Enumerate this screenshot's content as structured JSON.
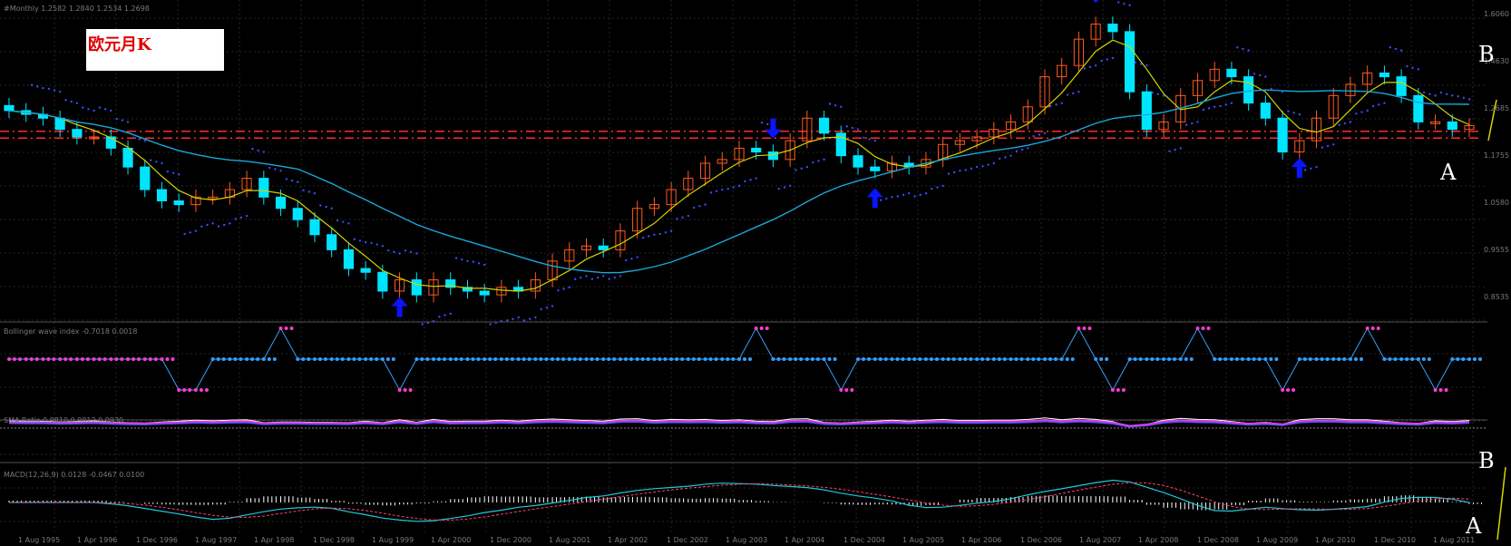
{
  "title_label": "欧元月K",
  "annotations": {
    "b_upper": "B",
    "a_upper": "A",
    "b_lower": "B",
    "a_lower": "A"
  },
  "panel_headers": {
    "main": "#Monthly  1.2582  1.2840  1.2534  1.2698",
    "panel2": "Bollinger wave index  -0.7018  0.0018",
    "panel3": "SMA Ratio 0.9810 0.9812 0.0930",
    "panel4": "MACD(12,26,9)  0.0128  -0.0467  0.0100"
  },
  "x_tick_labels": [
    "1 Aug 1995",
    "1 Apr 1996",
    "1 Dec 1996",
    "1 Aug 1997",
    "1 Apr 1998",
    "1 Dec 1998",
    "1 Aug 1999",
    "1 Apr 2000",
    "1 Dec 2000",
    "1 Aug 2001",
    "1 Apr 2002",
    "1 Dec 2002",
    "1 Aug 2003",
    "1 Apr 2004",
    "1 Dec 2004",
    "1 Aug 2005",
    "1 Apr 2006",
    "1 Dec 2006",
    "1 Aug 2007",
    "1 Apr 2008",
    "1 Dec 2008",
    "1 Aug 2009",
    "1 Apr 2010",
    "1 Dec 2010",
    "1 Aug 2011"
  ],
  "y_tick_labels_main": [
    "1.6060",
    "1.4630",
    "1.2685",
    "1.1755",
    "1.0580",
    "0.9555",
    "0.8535"
  ],
  "colors": {
    "background": "#000000",
    "up_candle": "#ff5a1e",
    "down_candle": "#00e5ff",
    "ma_short": "#d4d400",
    "ma_long": "#1aa7d8",
    "sar_dots": "#3b4cff",
    "support_line": "#ff2a2a",
    "signal_arrows": "#0a14ff",
    "wave_high": "#ff3cd2",
    "wave_low": "#33a0ff",
    "macd_line": "#1ec8d8",
    "signal_line": "#ff4070",
    "histogram": "#ffffff"
  },
  "chart_data": [
    {
      "type": "candlestick",
      "series": [
        {
          "name": "close",
          "values": [
            1.35,
            1.34,
            1.33,
            1.3,
            1.28,
            1.28,
            1.25,
            1.2,
            1.14,
            1.11,
            1.1,
            1.12,
            1.12,
            1.14,
            1.17,
            1.12,
            1.09,
            1.06,
            1.02,
            0.98,
            0.93,
            0.92,
            0.87,
            0.9,
            0.86,
            0.9,
            0.88,
            0.87,
            0.86,
            0.88,
            0.87,
            0.9,
            0.95,
            0.98,
            0.99,
            0.98,
            1.03,
            1.09,
            1.1,
            1.14,
            1.17,
            1.21,
            1.22,
            1.25,
            1.24,
            1.22,
            1.27,
            1.33,
            1.29,
            1.23,
            1.2,
            1.19,
            1.21,
            1.2,
            1.22,
            1.26,
            1.27,
            1.28,
            1.3,
            1.32,
            1.36,
            1.44,
            1.47,
            1.54,
            1.58,
            1.56,
            1.4,
            1.3,
            1.32,
            1.39,
            1.43,
            1.46,
            1.44,
            1.37,
            1.33,
            1.24,
            1.27,
            1.33,
            1.39,
            1.42,
            1.45,
            1.44,
            1.39,
            1.32,
            1.32,
            1.3,
            1.31
          ]
        }
      ],
      "markers": [
        {
          "type": "arrow-up",
          "at_index": 23
        },
        {
          "type": "arrow-down",
          "at_index": 45
        },
        {
          "type": "arrow-up",
          "at_index": 51
        },
        {
          "type": "arrow-down",
          "at_index": 64
        },
        {
          "type": "arrow-up",
          "at_index": 76
        }
      ],
      "lines": [
        "short moving average",
        "long moving average",
        "parabolic SAR dots",
        "horizontal support level"
      ]
    },
    {
      "type": "line",
      "series": [
        {
          "name": "wave index",
          "values": [
            0,
            0,
            0,
            0,
            0,
            0,
            0,
            0,
            0,
            0,
            -1,
            -1,
            0,
            0,
            0,
            0,
            1,
            0,
            0,
            0,
            0,
            0,
            0,
            -1,
            0,
            0,
            0,
            0,
            0,
            0,
            0,
            0,
            0,
            0,
            0,
            0,
            0,
            0,
            0,
            0,
            0,
            0,
            0,
            0,
            1,
            0,
            0,
            0,
            0,
            -1,
            0,
            0,
            0,
            0,
            0,
            0,
            0,
            0,
            0,
            0,
            0,
            0,
            0,
            1,
            0,
            -1,
            0,
            0,
            0,
            0,
            1,
            0,
            0,
            0,
            0,
            -1,
            0,
            0,
            0,
            0,
            1,
            0,
            0,
            0,
            -1,
            0,
            0
          ]
        }
      ]
    },
    {
      "type": "line",
      "series": [
        {
          "name": "oscillator",
          "values": []
        }
      ]
    },
    {
      "type": "line",
      "series": [
        {
          "name": "macd",
          "values": []
        },
        {
          "name": "signal",
          "values": []
        }
      ]
    }
  ]
}
